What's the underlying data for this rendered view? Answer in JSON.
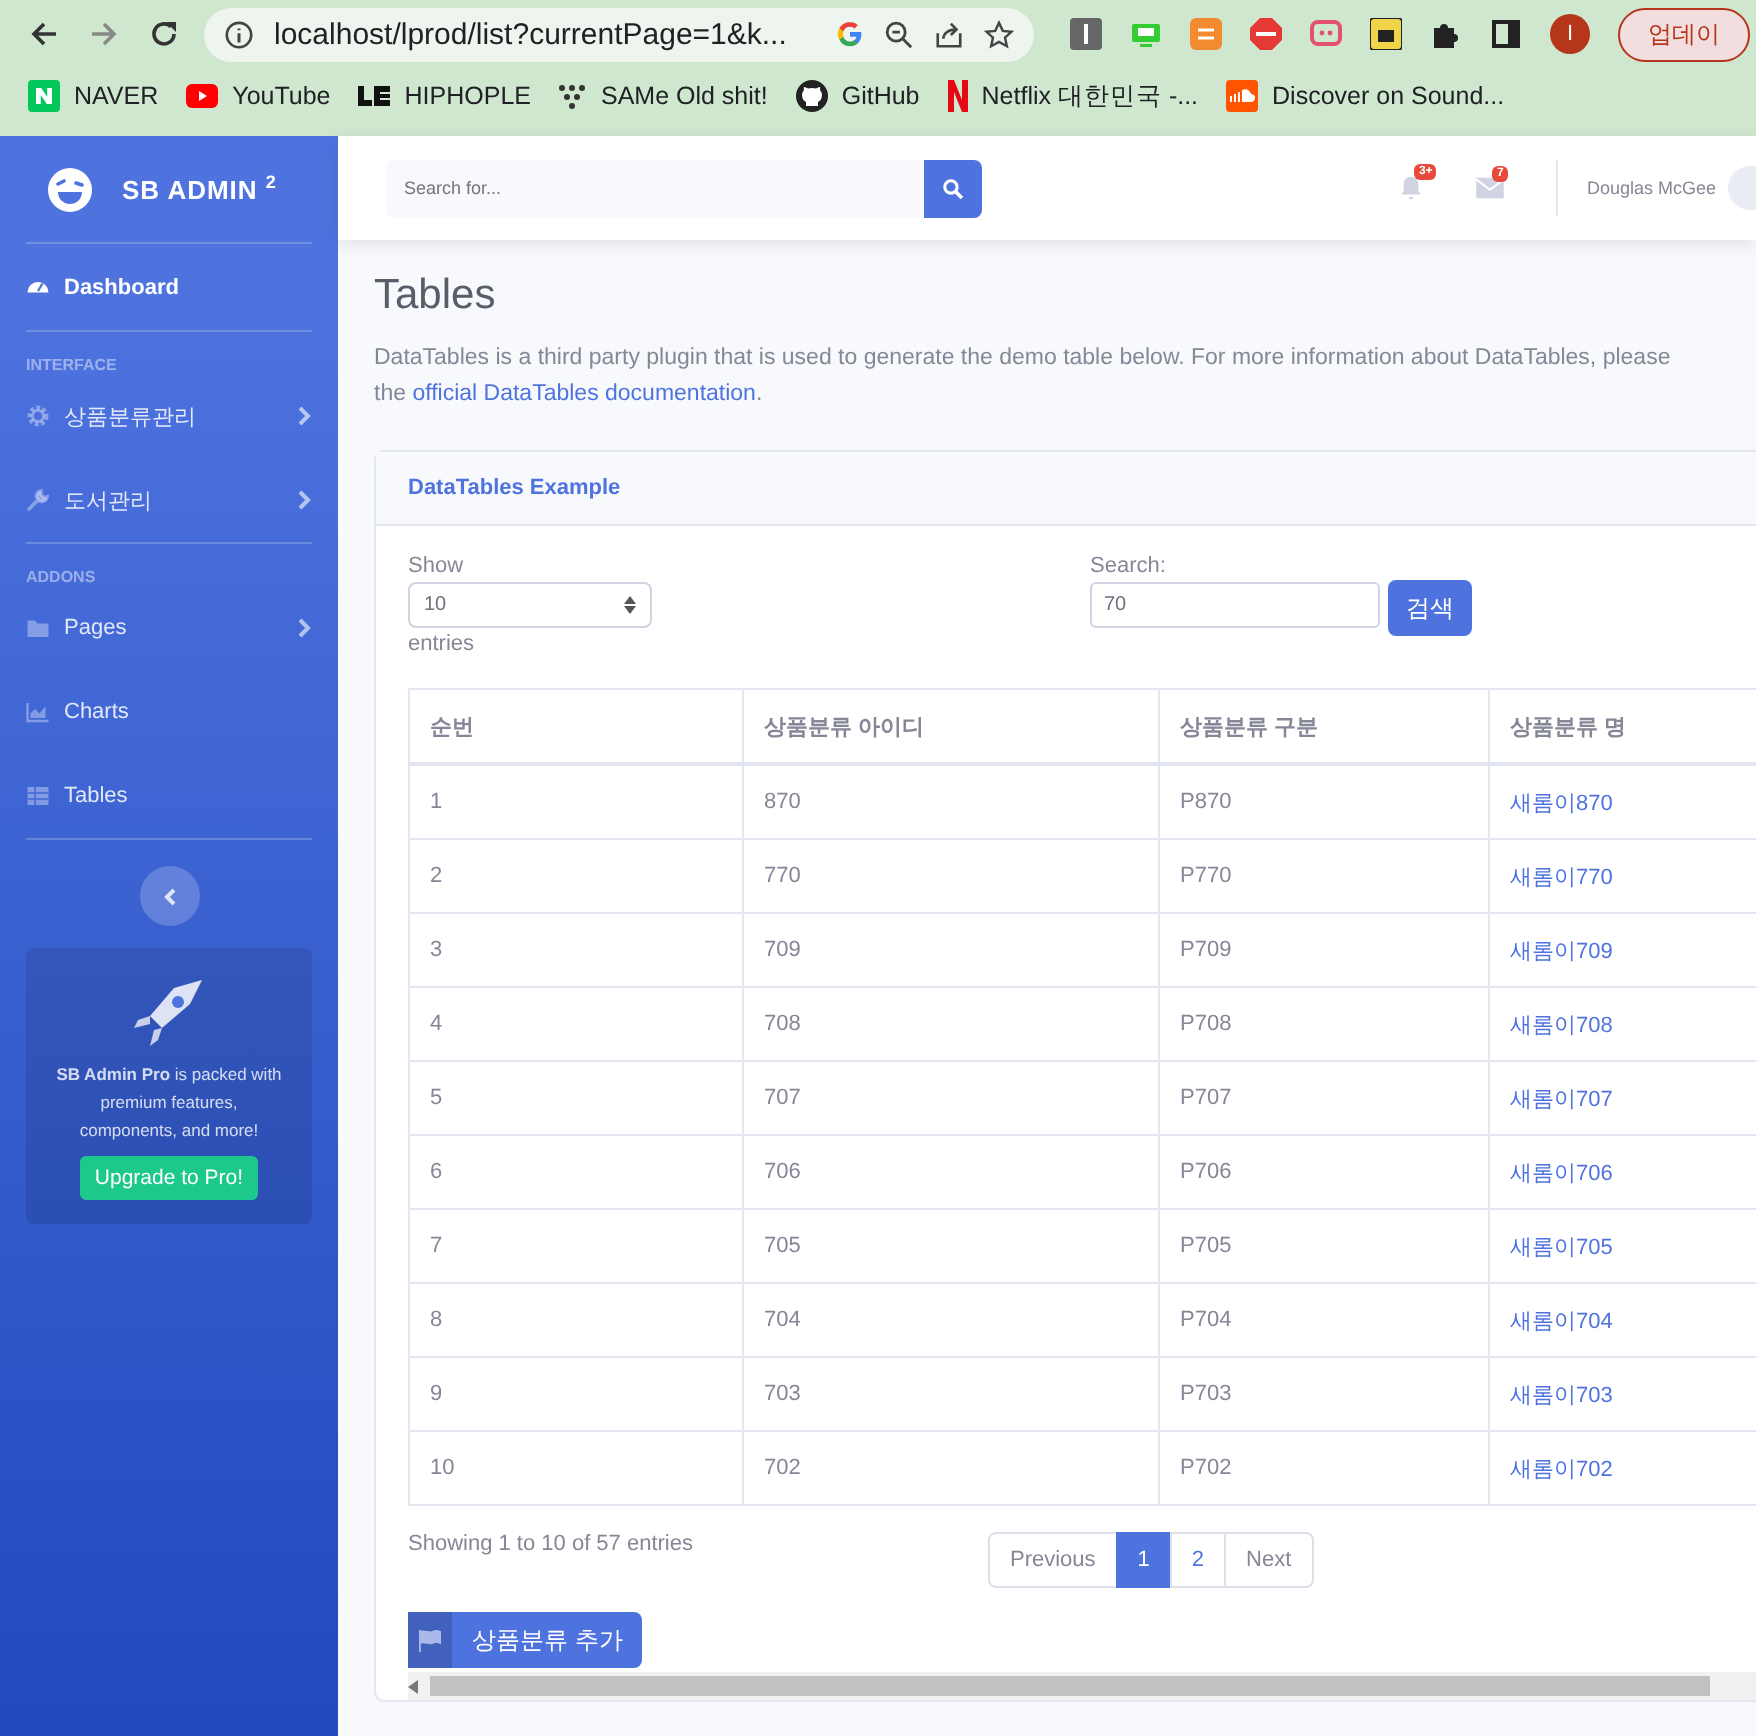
{
  "browser": {
    "url": "localhost/lprod/list?currentPage=1&k...",
    "profile_initial": "I",
    "update_button": "업데이",
    "bookmarks": [
      "NAVER",
      "YouTube",
      "HIPHOPLE",
      "SAMe Old shit!",
      "GitHub",
      "Netflix 대한민국 -...",
      "Discover on Sound..."
    ]
  },
  "sidebar": {
    "brand": "SB ADMIN $^{2}$",
    "sections": [
      {
        "items": [
          {
            "label": "Dashboard",
            "selected": true,
            "arrow": false
          }
        ]
      },
      {
        "heading": "INTERFACE",
        "items": [
          {
            "label": "상품분류관리",
            "selected": false,
            "arrow": true
          },
          {
            "label": "도서관리",
            "selected": false,
            "arrow": true
          }
        ]
      },
      {
        "heading": "ADDONS",
        "items": [
          {
            "label": "Pages",
            "selected": false,
            "arrow": true
          },
          {
            "label": "Charts",
            "selected": false,
            "arrow": false
          },
          {
            "label": "Tables",
            "selected": false,
            "arrow": false
          }
        ]
      }
    ],
    "promo": {
      "text": "**SB Admin Pro** is packed with premium features, components, and more!",
      "button": "Upgrade to Pro!"
    }
  },
  "topbar": {
    "search_placeholder": "Search for...",
    "alerts_badge": "3+",
    "messages_badge": "7",
    "user_name": "Douglas McGee"
  },
  "page": {
    "title": "Tables",
    "description": "DataTables is a third party plugin that is used to generate the demo table below. For more information about DataTables, please",
    "description_line_2": "the",
    "description_link": "official DataTables documentation",
    "description_end": "."
  },
  "card": {
    "title": "DataTables Example",
    "show_label": "Show",
    "page_size": "10",
    "entries_label": "entries",
    "search_label": "Search:",
    "search_value": "70",
    "search_button": "검색",
    "table": {
      "columns": [
        "순번",
        "상품분류 아이디",
        "상품분류 구분",
        "상품분류 명"
      ],
      "rows": [
        [
          "1",
          "870",
          "P870",
          "새롬이870"
        ],
        [
          "2",
          "770",
          "P770",
          "새롬이770"
        ],
        [
          "3",
          "709",
          "P709",
          "새롬이709"
        ],
        [
          "4",
          "708",
          "P708",
          "새롬이708"
        ],
        [
          "5",
          "707",
          "P707",
          "새롬이707"
        ],
        [
          "6",
          "706",
          "P706",
          "새롬이706"
        ],
        [
          "7",
          "705",
          "P705",
          "새롬이705"
        ],
        [
          "8",
          "704",
          "P704",
          "새롬이704"
        ],
        [
          "9",
          "703",
          "P703",
          "새롬이703"
        ],
        [
          "10",
          "702",
          "P702",
          "새롬이702"
        ]
      ]
    },
    "info": "Showing 1 to 10 of 57 entries",
    "pagination": [
      {
        "label": "Previous",
        "selected": false
      },
      {
        "label": "1",
        "selected": true
      },
      {
        "label": "2",
        "selected": false
      },
      {
        "label": "Next",
        "selected": false
      }
    ],
    "add_button": "상품분류 추가"
  }
}
